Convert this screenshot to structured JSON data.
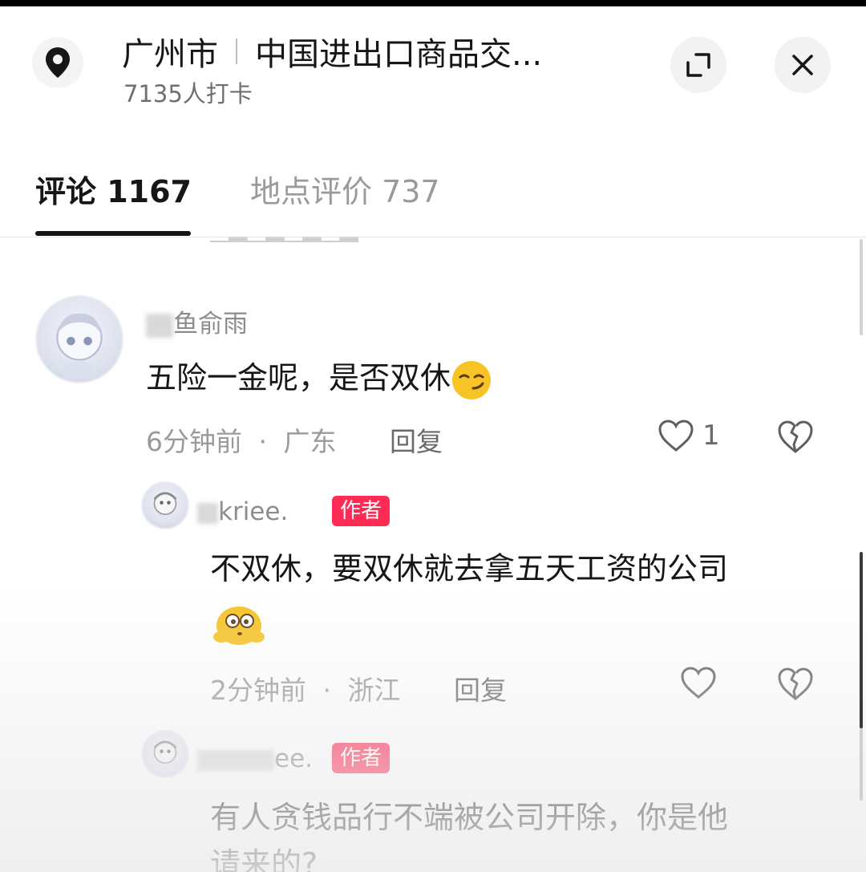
{
  "header": {
    "city": "广州市",
    "venue": "中国进出口商品交...",
    "checkins": "7135人打卡"
  },
  "tabs": [
    {
      "label": "评论 1167",
      "active": true
    },
    {
      "label": "地点评价 737",
      "active": false
    }
  ],
  "comments": [
    {
      "username_visible": "鱼俞雨",
      "text": "五险一金呢，是否双休",
      "emoji": "smirk-emoji",
      "time": "6分钟前",
      "sep": "·",
      "region": "广东",
      "reply_label": "回复",
      "likes": "1"
    }
  ],
  "replies": [
    {
      "username_visible": "kriee.",
      "badge": "作者",
      "text_line1": "不双休，要双休就去拿五天工资的公司",
      "emoji": "wide-eyed-emoji",
      "time": "2分钟前",
      "sep": "·",
      "region": "浙江",
      "reply_label": "回复"
    },
    {
      "username_visible": "ee.",
      "badge": "作者",
      "text_line1": "有人贪钱品行不端被公司开除，你是他",
      "text_line2": "请来的?"
    }
  ],
  "colors": {
    "badge": "#fe2c55",
    "primary_text": "#161616",
    "secondary_text": "#9a9a9a",
    "emoji": "#f7c325"
  }
}
